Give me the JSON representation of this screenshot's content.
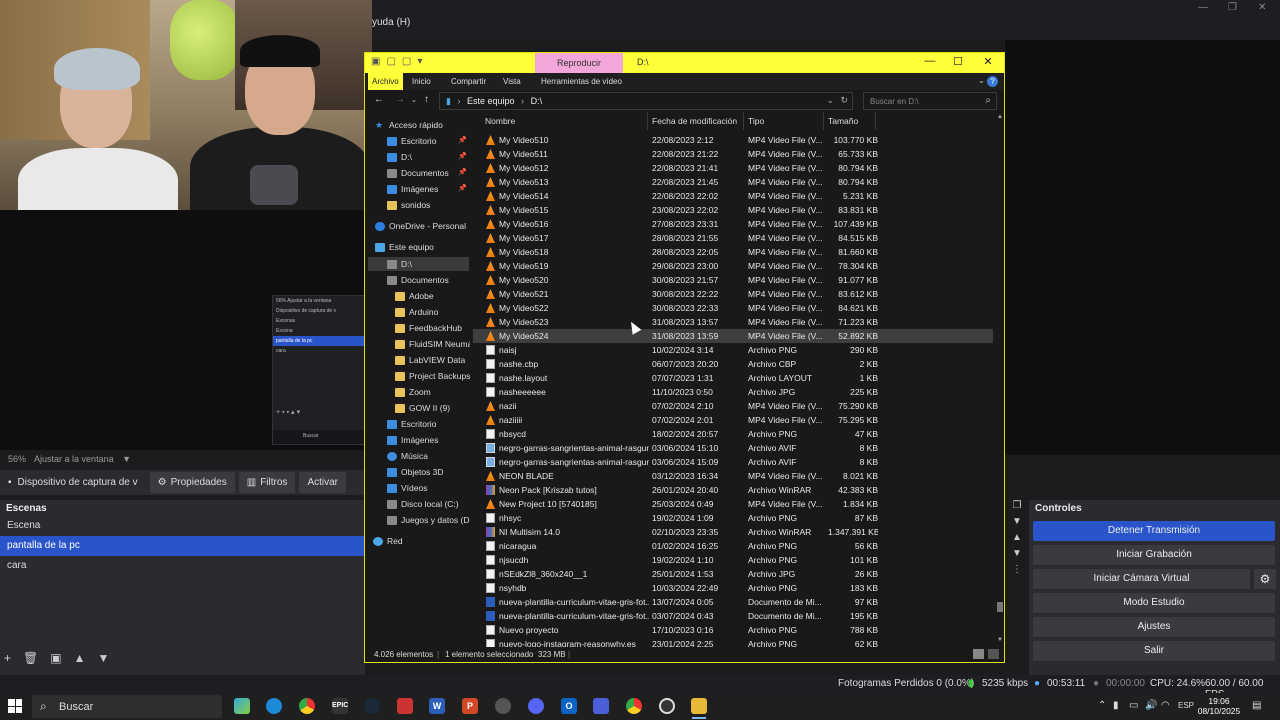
{
  "obs": {
    "menu_fragment": "yuda (H)",
    "zoom_text": "56%",
    "zoom_fit": "Ajustar a la ventana",
    "source_name": "Dispositivo de captura de v",
    "properties_label": "Propiedades",
    "filters_label": "Filtros",
    "activate_label": "Activar",
    "scenes_title": "Escenas",
    "scenes": [
      "Escena",
      "pantalla de la pc",
      "cara"
    ],
    "selected_scene_index": 1,
    "controls_title": "Controles",
    "controls": {
      "stop_stream": "Detener Transmisión",
      "start_recording": "Iniciar Grabación",
      "start_virtual_cam": "Iniciar Cámara Virtual",
      "studio_mode": "Modo Estudio",
      "settings": "Ajustes",
      "exit": "Salir"
    },
    "status": {
      "dropped_frames": "Fotogramas Perdidos 0 (0.0%)",
      "bitrate": "5235 kbps",
      "stream_time": "00:53:11",
      "rec_time": "00:00:00",
      "cpu": "CPU: 24.6%",
      "fps": "60.00 / 60.00 FPS"
    },
    "mini_preview": {
      "zoom": "56%",
      "fit": "Ajustar a la ventana",
      "source": "Dispositivo de captura de v",
      "scenes_title": "Escenas",
      "scenes": [
        "Escena",
        "pantalla de la pc",
        "cara"
      ],
      "search": "Buscar"
    }
  },
  "explorer": {
    "context_tab": "Reproducir",
    "title": "D:\\",
    "ribbon_tabs": [
      "Archivo",
      "Inicio",
      "Compartir",
      "Vista",
      "Herramientas de vídeo"
    ],
    "address": [
      "Este equipo",
      "D:\\"
    ],
    "search_placeholder": "Buscar en D:\\",
    "nav": [
      {
        "label": "Acceso rápido",
        "icon": "star-icon"
      },
      {
        "label": "Escritorio",
        "icon": "desktop-icon",
        "pinned": true
      },
      {
        "label": "D:\\",
        "icon": "download-icon",
        "pinned": true
      },
      {
        "label": "Documentos",
        "icon": "documents-icon",
        "pinned": true
      },
      {
        "label": "Imágenes",
        "icon": "pictures-icon",
        "pinned": true
      },
      {
        "label": "sonidos",
        "icon": "folder-icon"
      },
      {
        "label": "OneDrive - Personal",
        "icon": "onedrive-icon"
      },
      {
        "label": "Este equipo",
        "icon": "pc-icon"
      },
      {
        "label": "D:\\",
        "icon": "drive-icon",
        "selected": true
      },
      {
        "label": "Documentos",
        "icon": "documents-icon"
      },
      {
        "label": "Adobe",
        "icon": "folder-icon"
      },
      {
        "label": "Arduino",
        "icon": "folder-icon"
      },
      {
        "label": "FeedbackHub",
        "icon": "folder-icon"
      },
      {
        "label": "FluidSIM Neumáti",
        "icon": "folder-icon"
      },
      {
        "label": "LabVIEW Data",
        "icon": "folder-icon"
      },
      {
        "label": "Project Backups",
        "icon": "folder-icon"
      },
      {
        "label": "Zoom",
        "icon": "folder-icon"
      },
      {
        "label": "GOW II (9)",
        "icon": "folder-icon"
      },
      {
        "label": "Escritorio",
        "icon": "desktop-icon"
      },
      {
        "label": "Imágenes",
        "icon": "pictures-icon"
      },
      {
        "label": "Música",
        "icon": "music-icon"
      },
      {
        "label": "Objetos 3D",
        "icon": "objects3d-icon"
      },
      {
        "label": "Vídeos",
        "icon": "videos-icon"
      },
      {
        "label": "Disco local (C:)",
        "icon": "drive-icon"
      },
      {
        "label": "Juegos y datos (D:)",
        "icon": "drive-icon"
      },
      {
        "label": "Red",
        "icon": "network-icon"
      }
    ],
    "columns": [
      "Nombre",
      "Fecha de modificación",
      "Tipo",
      "Tamaño"
    ],
    "files": [
      {
        "name": "My Video510",
        "date": "22/08/2023 2:12",
        "type": "MP4 Video File (V...",
        "size": "103.770 KB",
        "icon": "vlc"
      },
      {
        "name": "My Video511",
        "date": "22/08/2023 21:22",
        "type": "MP4 Video File (V...",
        "size": "65.733 KB",
        "icon": "vlc"
      },
      {
        "name": "My Video512",
        "date": "22/08/2023 21:41",
        "type": "MP4 Video File (V...",
        "size": "80.794 KB",
        "icon": "vlc"
      },
      {
        "name": "My Video513",
        "date": "22/08/2023 21:45",
        "type": "MP4 Video File (V...",
        "size": "80.794 KB",
        "icon": "vlc"
      },
      {
        "name": "My Video514",
        "date": "22/08/2023 22:02",
        "type": "MP4 Video File (V...",
        "size": "5.231 KB",
        "icon": "vlc"
      },
      {
        "name": "My Video515",
        "date": "23/08/2023 22:02",
        "type": "MP4 Video File (V...",
        "size": "83.831 KB",
        "icon": "vlc"
      },
      {
        "name": "My Video516",
        "date": "27/08/2023 23:31",
        "type": "MP4 Video File (V...",
        "size": "107.439 KB",
        "icon": "vlc"
      },
      {
        "name": "My Video517",
        "date": "28/08/2023 21:55",
        "type": "MP4 Video File (V...",
        "size": "84.515 KB",
        "icon": "vlc"
      },
      {
        "name": "My Video518",
        "date": "28/08/2023 22:05",
        "type": "MP4 Video File (V...",
        "size": "81.660 KB",
        "icon": "vlc"
      },
      {
        "name": "My Video519",
        "date": "29/08/2023 23:00",
        "type": "MP4 Video File (V...",
        "size": "78.304 KB",
        "icon": "vlc"
      },
      {
        "name": "My Video520",
        "date": "30/08/2023 21:57",
        "type": "MP4 Video File (V...",
        "size": "91.077 KB",
        "icon": "vlc"
      },
      {
        "name": "My Video521",
        "date": "30/08/2023 22:22",
        "type": "MP4 Video File (V...",
        "size": "83.612 KB",
        "icon": "vlc"
      },
      {
        "name": "My Video522",
        "date": "30/08/2023 22:33",
        "type": "MP4 Video File (V...",
        "size": "84.621 KB",
        "icon": "vlc"
      },
      {
        "name": "My Video523",
        "date": "31/08/2023 13:57",
        "type": "MP4 Video File (V...",
        "size": "71.223 KB",
        "icon": "vlc"
      },
      {
        "name": "My Video524",
        "date": "31/08/2023 13:59",
        "type": "MP4 Video File (V...",
        "size": "52.892 KB",
        "icon": "vlc",
        "selected": true
      },
      {
        "name": "naisj",
        "date": "10/02/2024 3:14",
        "type": "Archivo PNG",
        "size": "290 KB",
        "icon": "doc"
      },
      {
        "name": "nashe.cbp",
        "date": "06/07/2023 20:20",
        "type": "Archivo CBP",
        "size": "2 KB",
        "icon": "doc"
      },
      {
        "name": "nashe.layout",
        "date": "07/07/2023 1:31",
        "type": "Archivo LAYOUT",
        "size": "1 KB",
        "icon": "doc"
      },
      {
        "name": "nasheeeeee",
        "date": "11/10/2023 0:50",
        "type": "Archivo JPG",
        "size": "225 KB",
        "icon": "doc"
      },
      {
        "name": "nazii",
        "date": "07/02/2024 2:10",
        "type": "MP4 Video File (V...",
        "size": "75.290 KB",
        "icon": "vlc"
      },
      {
        "name": "naziiiii",
        "date": "07/02/2024 2:01",
        "type": "MP4 Video File (V...",
        "size": "75.295 KB",
        "icon": "vlc"
      },
      {
        "name": "nbsycd",
        "date": "18/02/2024 20:57",
        "type": "Archivo PNG",
        "size": "47 KB",
        "icon": "doc"
      },
      {
        "name": "negro-garras-sangrientas-animal-rasgun...",
        "date": "03/06/2024 15:10",
        "type": "Archivo AVIF",
        "size": "8 KB",
        "icon": "img"
      },
      {
        "name": "negro-garras-sangrientas-animal-rasgun...",
        "date": "03/06/2024 15:09",
        "type": "Archivo AVIF",
        "size": "8 KB",
        "icon": "img"
      },
      {
        "name": "NEON BLADE",
        "date": "03/12/2023 16:34",
        "type": "MP4 Video File (V...",
        "size": "8.021 KB",
        "icon": "vlc"
      },
      {
        "name": "Neon Pack [Kriszab tutos]",
        "date": "26/01/2024 20:40",
        "type": "Archivo WinRAR",
        "size": "42.383 KB",
        "icon": "rar"
      },
      {
        "name": "New Project 10 [5740185]",
        "date": "25/03/2024 0:49",
        "type": "MP4 Video File (V...",
        "size": "1.834 KB",
        "icon": "vlc"
      },
      {
        "name": "nhsyc",
        "date": "19/02/2024 1:09",
        "type": "Archivo PNG",
        "size": "87 KB",
        "icon": "doc"
      },
      {
        "name": "NI Multisim 14.0",
        "date": "02/10/2023 23:35",
        "type": "Archivo WinRAR",
        "size": "1.347.391 KB",
        "icon": "rar"
      },
      {
        "name": "nicaragua",
        "date": "01/02/2024 16:25",
        "type": "Archivo PNG",
        "size": "56 KB",
        "icon": "doc"
      },
      {
        "name": "njsucdh",
        "date": "19/02/2024 1:10",
        "type": "Archivo PNG",
        "size": "101 KB",
        "icon": "doc"
      },
      {
        "name": "nSEdkZl8_360x240__1",
        "date": "25/01/2024 1:53",
        "type": "Archivo JPG",
        "size": "26 KB",
        "icon": "doc"
      },
      {
        "name": "nsyhdb",
        "date": "10/03/2024 22:49",
        "type": "Archivo PNG",
        "size": "183 KB",
        "icon": "doc"
      },
      {
        "name": "nueva-plantilla-curriculum-vitae-gris-fot...",
        "date": "13/07/2024 0:05",
        "type": "Documento de Mi...",
        "size": "97 KB",
        "icon": "word"
      },
      {
        "name": "nueva-plantilla-curriculum-vitae-gris-fot...",
        "date": "03/07/2024 0:43",
        "type": "Documento de Mi...",
        "size": "195 KB",
        "icon": "word"
      },
      {
        "name": "Nuevo proyecto",
        "date": "17/10/2023 0:16",
        "type": "Archivo PNG",
        "size": "788 KB",
        "icon": "doc"
      },
      {
        "name": "nuevo-logo-instagram-reasonwhy.es_",
        "date": "23/01/2024 2:25",
        "type": "Archivo PNG",
        "size": "62 KB",
        "icon": "doc"
      }
    ],
    "status": {
      "items": "4.026 elementos",
      "selected": "1 elemento seleccionado",
      "size": "323 MB"
    }
  },
  "taskbar": {
    "search_placeholder": "Buscar",
    "language": "ESP",
    "time": "19:06",
    "date": "08/10/2025"
  }
}
